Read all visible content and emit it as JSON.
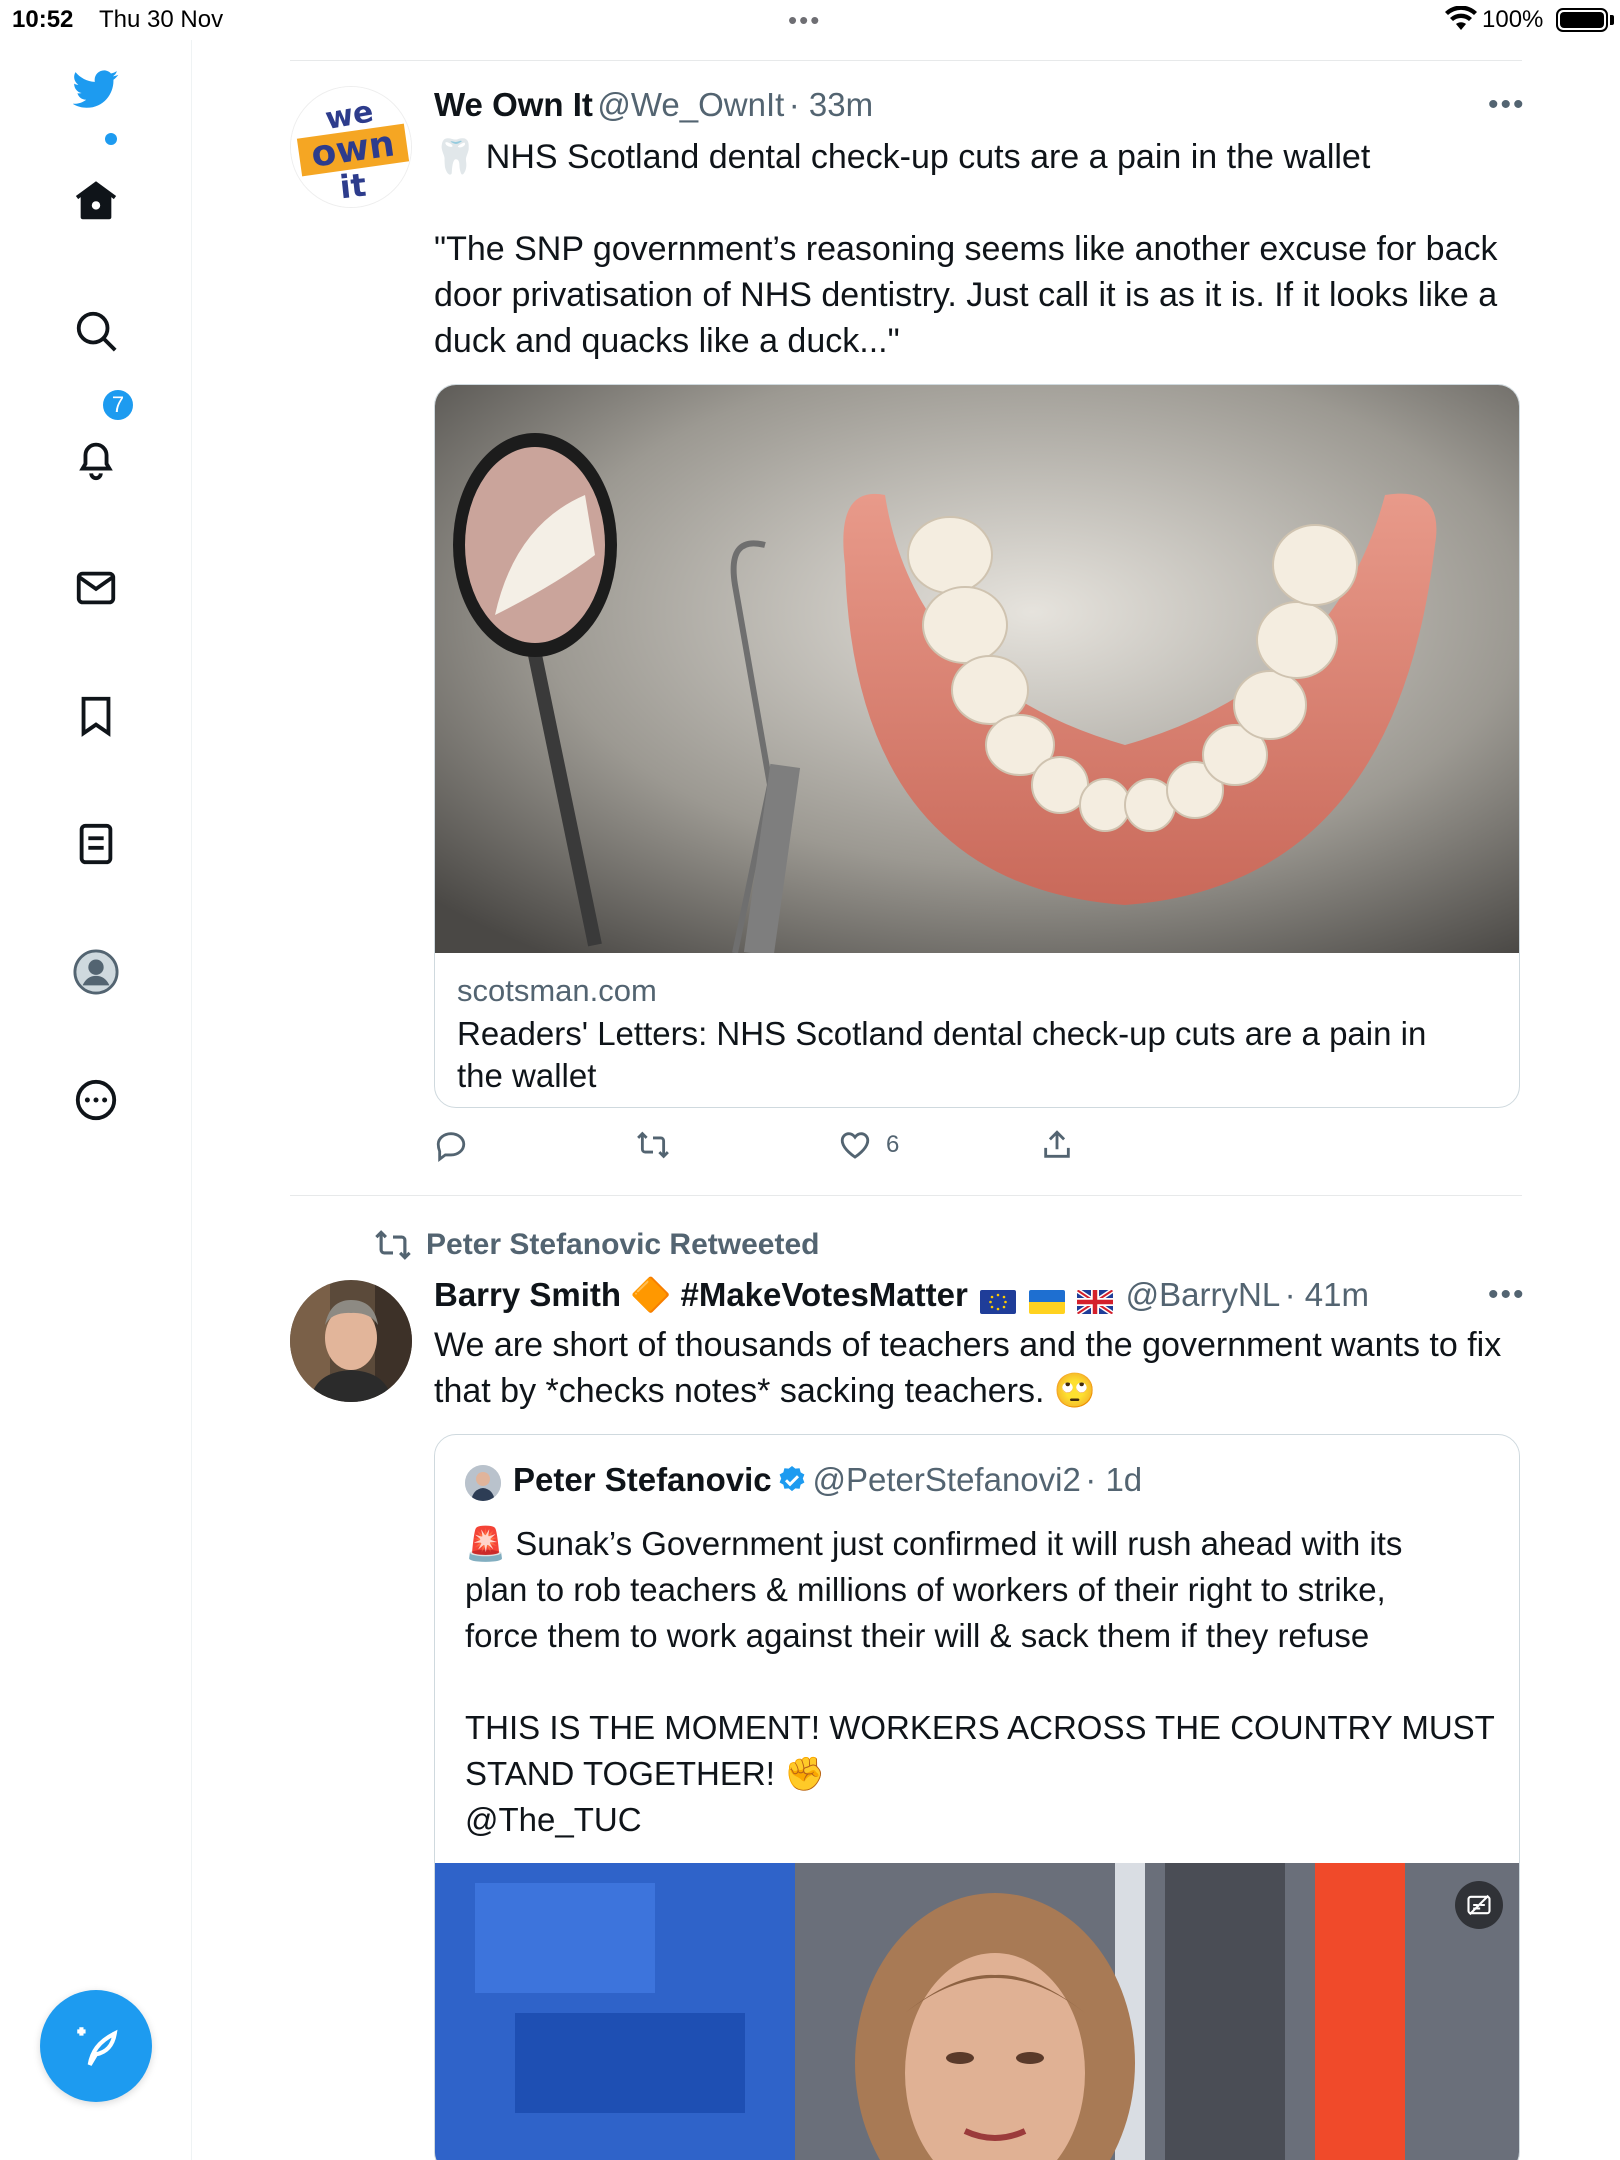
{
  "status_bar": {
    "time": "10:52",
    "date": "Thu 30 Nov",
    "battery": "100%"
  },
  "sidebar": {
    "notifications_badge": "7",
    "accent_color": "#1d9bf0",
    "items": [
      "twitter-logo",
      "home-icon",
      "search-icon",
      "bell-icon",
      "mail-icon",
      "bookmark-icon",
      "list-icon",
      "profile-icon",
      "more-icon"
    ]
  },
  "tweet1": {
    "avatar_text": "we own it",
    "name": "We Own It",
    "handle": "@We_OwnIt",
    "time": "· 33m",
    "line1": "🦷 NHS Scotland dental check-up cuts are a pain in the wallet",
    "body": "\"The SNP government’s reasoning seems like another excuse for back\ndoor privatisation of NHS dentistry. Just call it is as it is. If it looks like a\nduck and quacks like a duck...\"",
    "card_domain": "scotsman.com",
    "card_title": "Readers' Letters: NHS Scotland dental check-up cuts are a pain in\nthe wallet",
    "likes": "6"
  },
  "tweet2": {
    "retweeted_by": "Peter Stefanovic Retweeted",
    "name": "Barry Smith 🔶 #MakeVotesMatter",
    "handle": "@BarryNL",
    "time": "· 41m",
    "body": "We are short of thousands of teachers and the government wants to fix\nthat by *checks notes* sacking teachers. 🙄",
    "quote": {
      "name": "Peter Stefanovic",
      "handle": "@PeterStefanovi2",
      "time": "· 1d",
      "body": "🚨 Sunak’s Government just confirmed it will rush ahead with its\nplan to rob teachers & millions of workers of their right to strike,\nforce them to work against their will & sack them if they refuse\n\nTHIS IS THE MOMENT! WORKERS ACROSS THE COUNTRY MUST\nSTAND TOGETHER! ✊\n@The_TUC"
    }
  }
}
